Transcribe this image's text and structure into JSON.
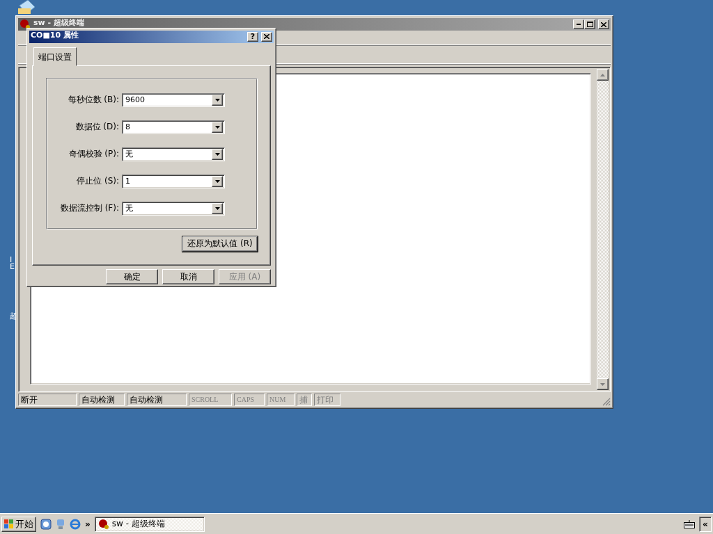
{
  "desktop": {
    "icon_labels": [
      "I",
      "E",
      "超"
    ]
  },
  "main_window": {
    "title": "sw - 超级终端",
    "active": false,
    "status_bar": [
      {
        "text": "断开",
        "disabled": false
      },
      {
        "text": "自动检测",
        "disabled": false
      },
      {
        "text": "自动检测",
        "disabled": false
      },
      {
        "text": "SCROLL",
        "disabled": true
      },
      {
        "text": "CAPS",
        "disabled": true
      },
      {
        "text": "NUM",
        "disabled": true
      },
      {
        "text": "捕",
        "disabled": true
      },
      {
        "text": "打印",
        "disabled": true
      }
    ]
  },
  "dialog": {
    "title": "CO■10 属性",
    "active": true,
    "help_button": "?",
    "tabs": [
      {
        "label": "端口设置",
        "selected": true
      }
    ],
    "fields": [
      {
        "label": "每秒位数 (B):",
        "value": "9600"
      },
      {
        "label": "数据位 (D):",
        "value": "8"
      },
      {
        "label": "奇偶校验 (P):",
        "value": "无"
      },
      {
        "label": "停止位 (S):",
        "value": "1"
      },
      {
        "label": "数据流控制 (F):",
        "value": "无"
      }
    ],
    "reset_button": {
      "label": "还原为默认值 (R)",
      "disabled": false
    },
    "buttons": [
      {
        "label": "确定",
        "disabled": false
      },
      {
        "label": "取消",
        "disabled": false
      },
      {
        "label": "应用 (A)",
        "disabled": true
      }
    ]
  },
  "taskbar": {
    "start": "开始",
    "more": "»",
    "tasks": [
      {
        "label": "sw - 超级终端",
        "selected": true
      }
    ],
    "tray_toggle": "«"
  }
}
